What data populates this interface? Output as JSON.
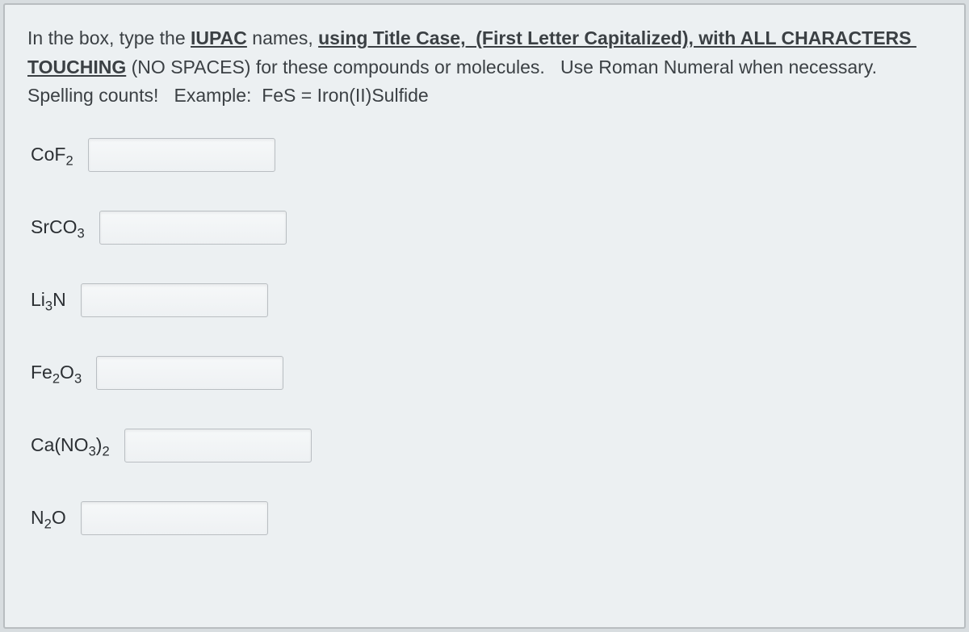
{
  "instructions": {
    "segments": [
      {
        "text": "In the box, type the ",
        "u": false,
        "b": false
      },
      {
        "text": "IUPAC",
        "u": true,
        "b": true
      },
      {
        "text": " names, ",
        "u": false,
        "b": false
      },
      {
        "text": "using Title Case,  (First Letter Capitalized), with ALL CHARACTERS TOUCHING",
        "u": true,
        "b": true
      },
      {
        "text": " (NO SPACES) for these compounds or molecules.   Use Roman Numeral when necessary.  Spelling counts!   Example:  FeS = Iron(II)Sulfide",
        "u": false,
        "b": false
      }
    ]
  },
  "items": [
    {
      "formula_html": "CoF<sub>2</sub>",
      "value": ""
    },
    {
      "formula_html": "SrCO<sub>3</sub>",
      "value": ""
    },
    {
      "formula_html": "Li<sub>3</sub>N",
      "value": ""
    },
    {
      "formula_html": "Fe<sub>2</sub>O<sub>3</sub>",
      "value": ""
    },
    {
      "formula_html": "Ca(NO<sub>3</sub>)<sub>2</sub>",
      "value": ""
    },
    {
      "formula_html": "N<sub>2</sub>O",
      "value": ""
    }
  ]
}
